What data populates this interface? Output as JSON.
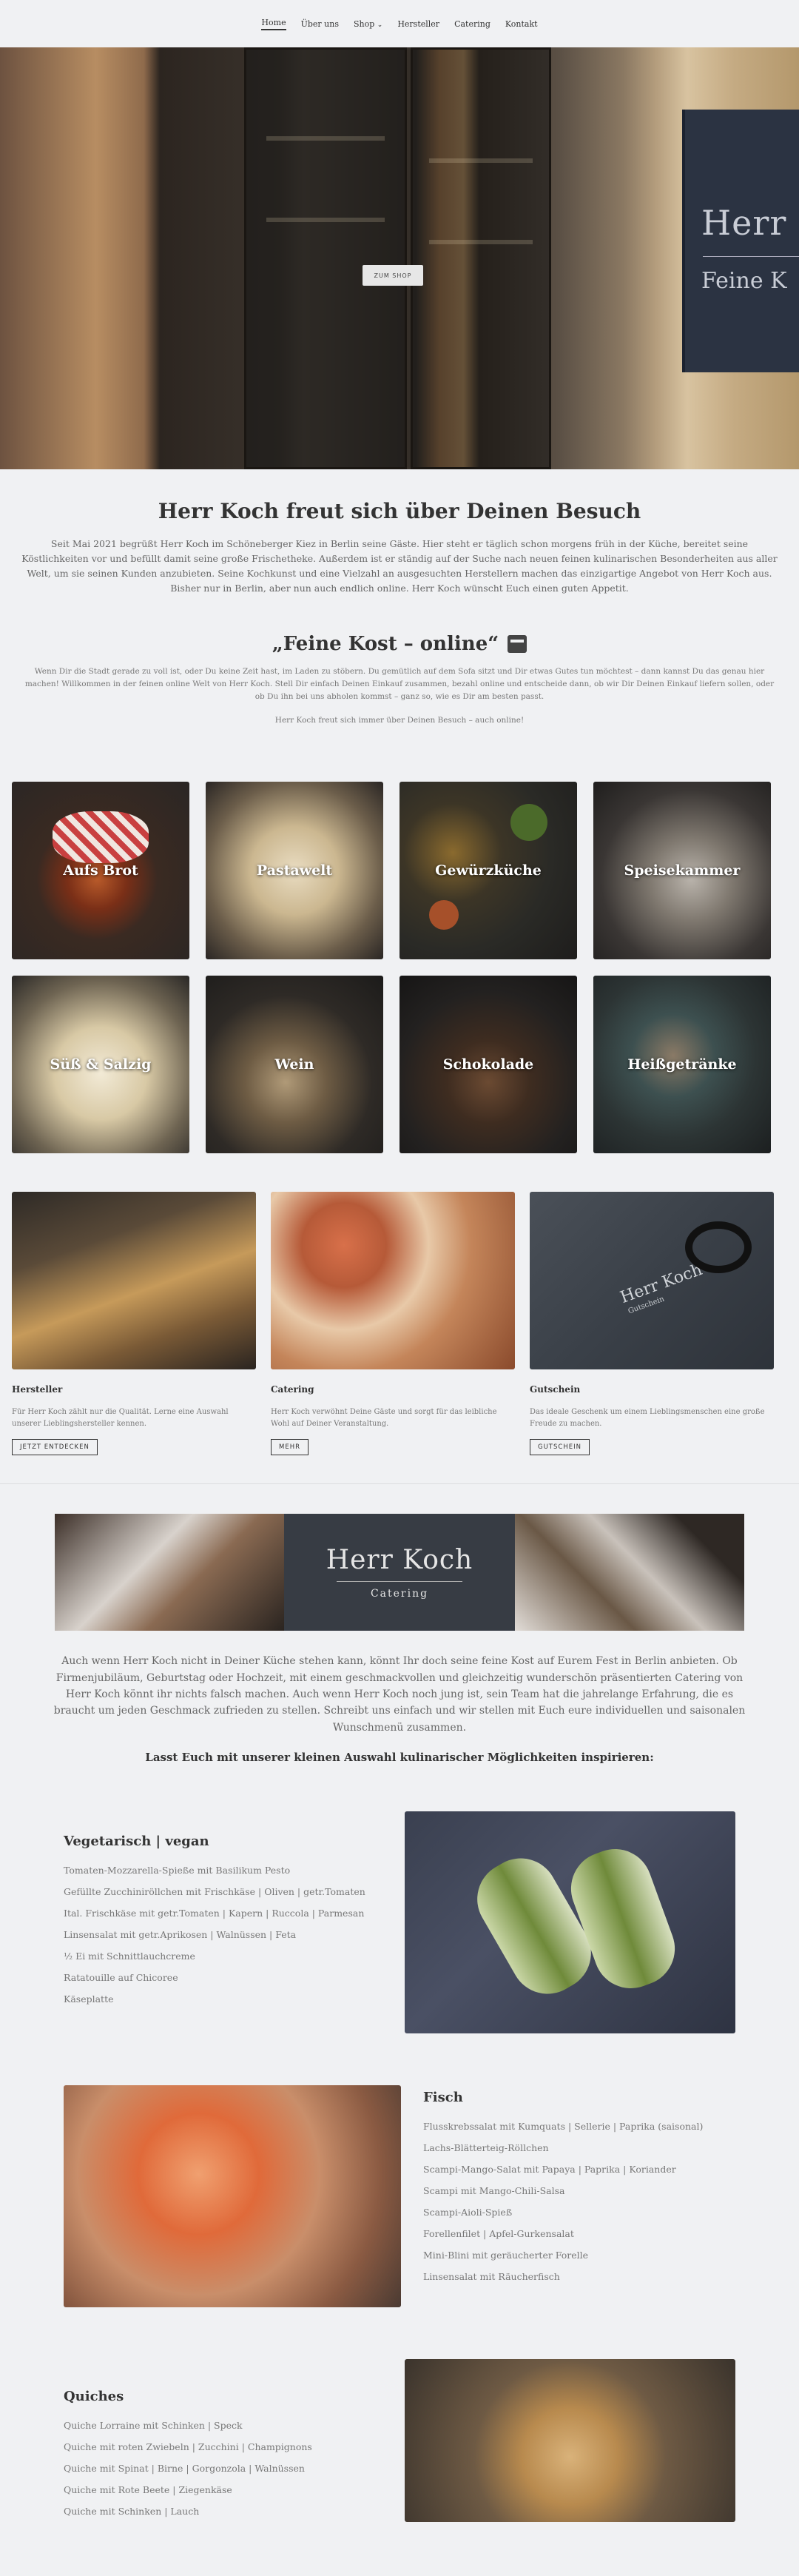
{
  "nav": {
    "items": [
      "Home",
      "Über uns",
      "Shop",
      "Hersteller",
      "Catering",
      "Kontakt"
    ],
    "shop_caret": "⌄"
  },
  "hero": {
    "button": "ZUM SHOP",
    "sign_title": "Herr Koch",
    "sign_sub": "Feine K"
  },
  "welcome": {
    "title": "Herr Koch freut sich über Deinen Besuch",
    "text": "Seit Mai 2021 begrüßt Herr Koch im Schöneberger Kiez in Berlin seine Gäste. Hier steht er täglich schon morgens früh in der Küche, bereitet seine Köstlichkeiten vor und befüllt damit seine große Frischetheke. Außerdem ist er ständig auf der Suche nach neuen feinen kulinarischen Besonderheiten aus aller Welt, um sie seinen Kunden anzubieten. Seine Kochkunst und eine Vielzahl an ausgesuchten Herstellern machen das einzigartige Angebot von Herr Koch aus. Bisher nur in Berlin, aber nun auch endlich online. Herr Koch wünscht Euch einen guten Appetit."
  },
  "feine": {
    "title": "„Feine Kost – online“",
    "text1": "Wenn Dir die Stadt gerade zu voll ist, oder Du keine Zeit hast, im Laden zu stöbern. Du gemütlich auf dem Sofa sitzt und Dir etwas Gutes tun möchtest – dann kannst Du das genau hier machen! Willkommen in der feinen online Welt von Herr Koch. Stell Dir einfach Deinen Einkauf zusammen, bezahl online und entscheide dann, ob wir Dir Deinen Einkauf liefern sollen, oder ob Du ihn bei uns abholen kommst – ganz so, wie es Dir am besten passt.",
    "text2": "Herr Koch freut sich immer über Deinen Besuch – auch online!"
  },
  "categories": [
    "Aufs Brot",
    "Pastawelt",
    "Gewürzküche",
    "Speisekammer",
    "Süß & Salzig",
    "Wein",
    "Schokolade",
    "Heißgetränke"
  ],
  "cards": [
    {
      "title": "Hersteller",
      "text": "Für Herr Koch zählt nur die Qualität. Lerne eine Auswahl unserer Lieblingshersteller kennen.",
      "button": "JETZT ENTDECKEN"
    },
    {
      "title": "Catering",
      "text": "Herr Koch verwöhnt Deine Gäste und sorgt für das leibliche Wohl auf Deiner Veranstaltung.",
      "button": "MEHR"
    },
    {
      "title": "Gutschein",
      "text": "Das ideale Geschenk um einem Lieblingsmenschen eine große Freude zu machen.",
      "button": "GUTSCHEIN"
    }
  ],
  "catering": {
    "banner_title": "Herr Koch",
    "banner_sub": "Catering",
    "voucher_title": "Herr Koch",
    "voucher_sub": "Gutschein",
    "text": "Auch wenn Herr Koch nicht in Deiner Küche stehen kann, könnt Ihr doch seine feine Kost auf Eurem Fest in Berlin anbieten. Ob Firmenjubiläum, Geburtstag oder Hochzeit, mit einem geschmackvollen und gleichzeitig wunderschön präsentierten Catering von Herr Koch könnt ihr nichts falsch machen. Auch wenn Herr Koch noch jung ist, sein Team hat die jahrelange Erfahrung, die es braucht um jeden Geschmack zufrieden zu stellen. Schreibt uns einfach und wir stellen mit Euch eure individuellen und saisonalen Wunschmenü zusammen.",
    "lead": "Lasst Euch mit unserer kleinen Auswahl kulinarischer Möglichkeiten inspirieren:"
  },
  "menus": {
    "veg": {
      "title": "Vegetarisch | vegan",
      "items": [
        "Tomaten-Mozzarella-Spieße mit Basilikum Pesto",
        "Gefüllte Zucchiniröllchen mit Frischkäse | Oliven | getr.Tomaten",
        "Ital. Frischkäse mit getr.Tomaten | Kapern | Ruccola | Parmesan",
        "Linsensalat mit getr.Aprikosen | Walnüssen | Feta",
        "½ Ei mit Schnittlauchcreme",
        "Ratatouille auf Chicoree",
        "Käseplatte"
      ]
    },
    "fisch": {
      "title": "Fisch",
      "items": [
        "Flusskrebssalat mit Kumquats | Sellerie | Paprika (saisonal)",
        "Lachs-Blätterteig-Röllchen",
        "Scampi-Mango-Salat mit Papaya | Paprika | Koriander",
        "Scampi mit Mango-Chili-Salsa",
        "Scampi-Aioli-Spieß",
        "Forellenfilet | Apfel-Gurkensalat",
        "Mini-Blini mit geräucherter Forelle",
        "Linsensalat mit Räucherfisch"
      ]
    },
    "quiches": {
      "title": "Quiches",
      "items": [
        "Quiche Lorraine mit Schinken | Speck",
        "Quiche mit roten Zwiebeln | Zucchini | Champignons",
        "Quiche mit Spinat | Birne | Gorgonzola | Walnüssen",
        "Quiche mit Rote Beete | Ziegenkäse",
        "Quiche mit Schinken | Lauch"
      ]
    }
  }
}
